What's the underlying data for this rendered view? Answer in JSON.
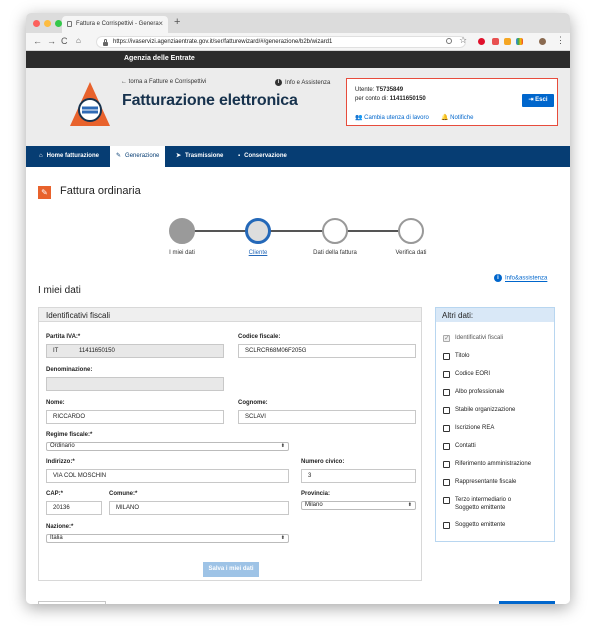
{
  "browser": {
    "tab_title": "Fattura e Corrispettivi - Genera",
    "url": "https://ivaservizi.agenziaentrate.gov.it/ser/fatturewizard/#/generazione/b2b/wizard1"
  },
  "header": {
    "agency_name": "Agenzia delle Entrate",
    "back_link": "torna a Fatture e Corrispettivi",
    "info_link": "Info e Assistenza",
    "app_title": "Fatturazione elettronica",
    "user_label": "Utente:",
    "user_id": "T5735849",
    "on_behalf_label": "per conto di:",
    "on_behalf_id": "11411650150",
    "change_user": "Cambia utenza di lavoro",
    "notifications": "Notifiche",
    "logout": "Esci"
  },
  "nav": {
    "tabs": [
      {
        "label": "Home fatturazione",
        "icon": "home-icon"
      },
      {
        "label": "Generazione",
        "icon": "pencil-icon"
      },
      {
        "label": "Trasmissione",
        "icon": "send-icon"
      },
      {
        "label": "Conservazione",
        "icon": "archive-icon"
      }
    ],
    "active": "Generazione"
  },
  "page": {
    "title": "Fattura ordinaria",
    "steps": [
      "I miei dati",
      "Cliente",
      "Dati della fattura",
      "Verifica dati"
    ],
    "current_step": "Cliente",
    "section_title": "I miei dati",
    "info_assistance": "Info&assistenza"
  },
  "form": {
    "panel_title": "Identificativi fiscali",
    "partita_iva_label": "Partita IVA:*",
    "partita_iva_country": "IT",
    "partita_iva_value": "11411650150",
    "codice_fiscale_label": "Codice fiscale:",
    "codice_fiscale_value": "SCLRCR68M06F205G",
    "denominazione_label": "Denominazione:",
    "denominazione_value": "",
    "nome_label": "Nome:",
    "nome_value": "RICCARDO",
    "cognome_label": "Cognome:",
    "cognome_value": "SCLAVI",
    "regime_label": "Regime fiscale:*",
    "regime_value": "Ordinario",
    "indirizzo_label": "Indirizzo:*",
    "indirizzo_value": "VIA COL MOSCHIN",
    "civico_label": "Numero civico:",
    "civico_value": "3",
    "cap_label": "CAP:*",
    "cap_value": "20136",
    "comune_label": "Comune:*",
    "comune_value": "MILANO",
    "provincia_label": "Provincia:",
    "provincia_value": "Milano",
    "nazione_label": "Nazione:*",
    "nazione_value": "Italia",
    "save_button": "Salva i miei dati"
  },
  "side": {
    "title": "Altri dati:",
    "items": [
      {
        "label": "Identificativi fiscali",
        "checked": true
      },
      {
        "label": "Titolo",
        "checked": false
      },
      {
        "label": "Codice EORI",
        "checked": false
      },
      {
        "label": "Albo professionale",
        "checked": false
      },
      {
        "label": "Stabile organizzazione",
        "checked": false
      },
      {
        "label": "Iscrizione REA",
        "checked": false
      },
      {
        "label": "Contatti",
        "checked": false
      },
      {
        "label": "Riferimento amministrazione",
        "checked": false
      },
      {
        "label": "Rappresentante fiscale",
        "checked": false
      },
      {
        "label": "Terzo intermediario o",
        "label2": "Soggetto emittente",
        "checked": false
      },
      {
        "label": "Soggetto emittente",
        "checked": false
      }
    ]
  },
  "colors": {
    "navy": "#063d73",
    "accent_blue": "#0066cc",
    "orange": "#e8622c",
    "alert_red": "#e74c3c"
  }
}
